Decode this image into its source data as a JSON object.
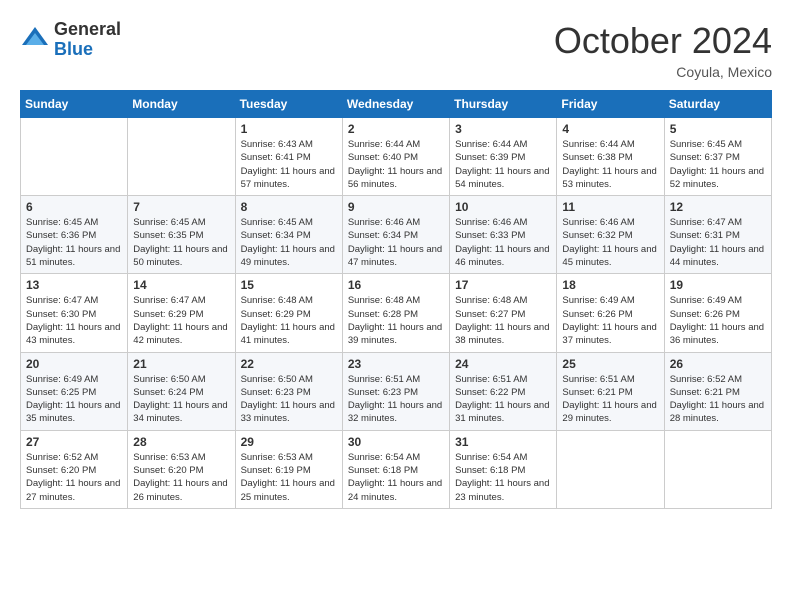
{
  "logo": {
    "general": "General",
    "blue": "Blue"
  },
  "header": {
    "month": "October 2024",
    "location": "Coyula, Mexico"
  },
  "weekdays": [
    "Sunday",
    "Monday",
    "Tuesday",
    "Wednesday",
    "Thursday",
    "Friday",
    "Saturday"
  ],
  "weeks": [
    [
      {
        "day": "",
        "info": ""
      },
      {
        "day": "",
        "info": ""
      },
      {
        "day": "1",
        "sunrise": "6:43 AM",
        "sunset": "6:41 PM",
        "daylight": "11 hours and 57 minutes."
      },
      {
        "day": "2",
        "sunrise": "6:44 AM",
        "sunset": "6:40 PM",
        "daylight": "11 hours and 56 minutes."
      },
      {
        "day": "3",
        "sunrise": "6:44 AM",
        "sunset": "6:39 PM",
        "daylight": "11 hours and 54 minutes."
      },
      {
        "day": "4",
        "sunrise": "6:44 AM",
        "sunset": "6:38 PM",
        "daylight": "11 hours and 53 minutes."
      },
      {
        "day": "5",
        "sunrise": "6:45 AM",
        "sunset": "6:37 PM",
        "daylight": "11 hours and 52 minutes."
      }
    ],
    [
      {
        "day": "6",
        "sunrise": "6:45 AM",
        "sunset": "6:36 PM",
        "daylight": "11 hours and 51 minutes."
      },
      {
        "day": "7",
        "sunrise": "6:45 AM",
        "sunset": "6:35 PM",
        "daylight": "11 hours and 50 minutes."
      },
      {
        "day": "8",
        "sunrise": "6:45 AM",
        "sunset": "6:34 PM",
        "daylight": "11 hours and 49 minutes."
      },
      {
        "day": "9",
        "sunrise": "6:46 AM",
        "sunset": "6:34 PM",
        "daylight": "11 hours and 47 minutes."
      },
      {
        "day": "10",
        "sunrise": "6:46 AM",
        "sunset": "6:33 PM",
        "daylight": "11 hours and 46 minutes."
      },
      {
        "day": "11",
        "sunrise": "6:46 AM",
        "sunset": "6:32 PM",
        "daylight": "11 hours and 45 minutes."
      },
      {
        "day": "12",
        "sunrise": "6:47 AM",
        "sunset": "6:31 PM",
        "daylight": "11 hours and 44 minutes."
      }
    ],
    [
      {
        "day": "13",
        "sunrise": "6:47 AM",
        "sunset": "6:30 PM",
        "daylight": "11 hours and 43 minutes."
      },
      {
        "day": "14",
        "sunrise": "6:47 AM",
        "sunset": "6:29 PM",
        "daylight": "11 hours and 42 minutes."
      },
      {
        "day": "15",
        "sunrise": "6:48 AM",
        "sunset": "6:29 PM",
        "daylight": "11 hours and 41 minutes."
      },
      {
        "day": "16",
        "sunrise": "6:48 AM",
        "sunset": "6:28 PM",
        "daylight": "11 hours and 39 minutes."
      },
      {
        "day": "17",
        "sunrise": "6:48 AM",
        "sunset": "6:27 PM",
        "daylight": "11 hours and 38 minutes."
      },
      {
        "day": "18",
        "sunrise": "6:49 AM",
        "sunset": "6:26 PM",
        "daylight": "11 hours and 37 minutes."
      },
      {
        "day": "19",
        "sunrise": "6:49 AM",
        "sunset": "6:26 PM",
        "daylight": "11 hours and 36 minutes."
      }
    ],
    [
      {
        "day": "20",
        "sunrise": "6:49 AM",
        "sunset": "6:25 PM",
        "daylight": "11 hours and 35 minutes."
      },
      {
        "day": "21",
        "sunrise": "6:50 AM",
        "sunset": "6:24 PM",
        "daylight": "11 hours and 34 minutes."
      },
      {
        "day": "22",
        "sunrise": "6:50 AM",
        "sunset": "6:23 PM",
        "daylight": "11 hours and 33 minutes."
      },
      {
        "day": "23",
        "sunrise": "6:51 AM",
        "sunset": "6:23 PM",
        "daylight": "11 hours and 32 minutes."
      },
      {
        "day": "24",
        "sunrise": "6:51 AM",
        "sunset": "6:22 PM",
        "daylight": "11 hours and 31 minutes."
      },
      {
        "day": "25",
        "sunrise": "6:51 AM",
        "sunset": "6:21 PM",
        "daylight": "11 hours and 29 minutes."
      },
      {
        "day": "26",
        "sunrise": "6:52 AM",
        "sunset": "6:21 PM",
        "daylight": "11 hours and 28 minutes."
      }
    ],
    [
      {
        "day": "27",
        "sunrise": "6:52 AM",
        "sunset": "6:20 PM",
        "daylight": "11 hours and 27 minutes."
      },
      {
        "day": "28",
        "sunrise": "6:53 AM",
        "sunset": "6:20 PM",
        "daylight": "11 hours and 26 minutes."
      },
      {
        "day": "29",
        "sunrise": "6:53 AM",
        "sunset": "6:19 PM",
        "daylight": "11 hours and 25 minutes."
      },
      {
        "day": "30",
        "sunrise": "6:54 AM",
        "sunset": "6:18 PM",
        "daylight": "11 hours and 24 minutes."
      },
      {
        "day": "31",
        "sunrise": "6:54 AM",
        "sunset": "6:18 PM",
        "daylight": "11 hours and 23 minutes."
      },
      {
        "day": "",
        "info": ""
      },
      {
        "day": "",
        "info": ""
      }
    ]
  ]
}
